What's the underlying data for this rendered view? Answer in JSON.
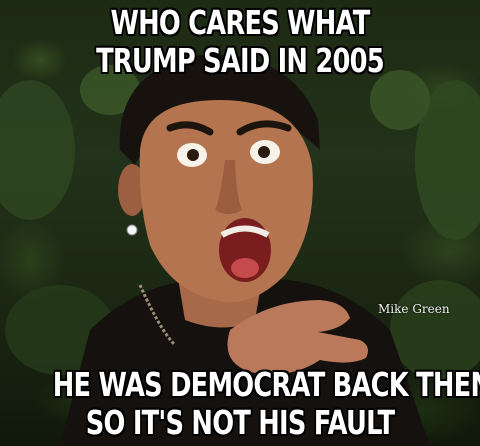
{
  "meme": {
    "top_caption": {
      "line1": "WHO CARES WHAT",
      "line2": "TRUMP SAID IN 2005"
    },
    "bottom_caption": {
      "line1": "HE WAS DEMOCRAT BACK THEN",
      "line2": "SO IT'S NOT HIS FAULT"
    },
    "watermark": "Mike Green"
  },
  "colors": {
    "caption_text": "#ffffff",
    "caption_outline": "#000000",
    "background_foliage": "#23321a"
  }
}
